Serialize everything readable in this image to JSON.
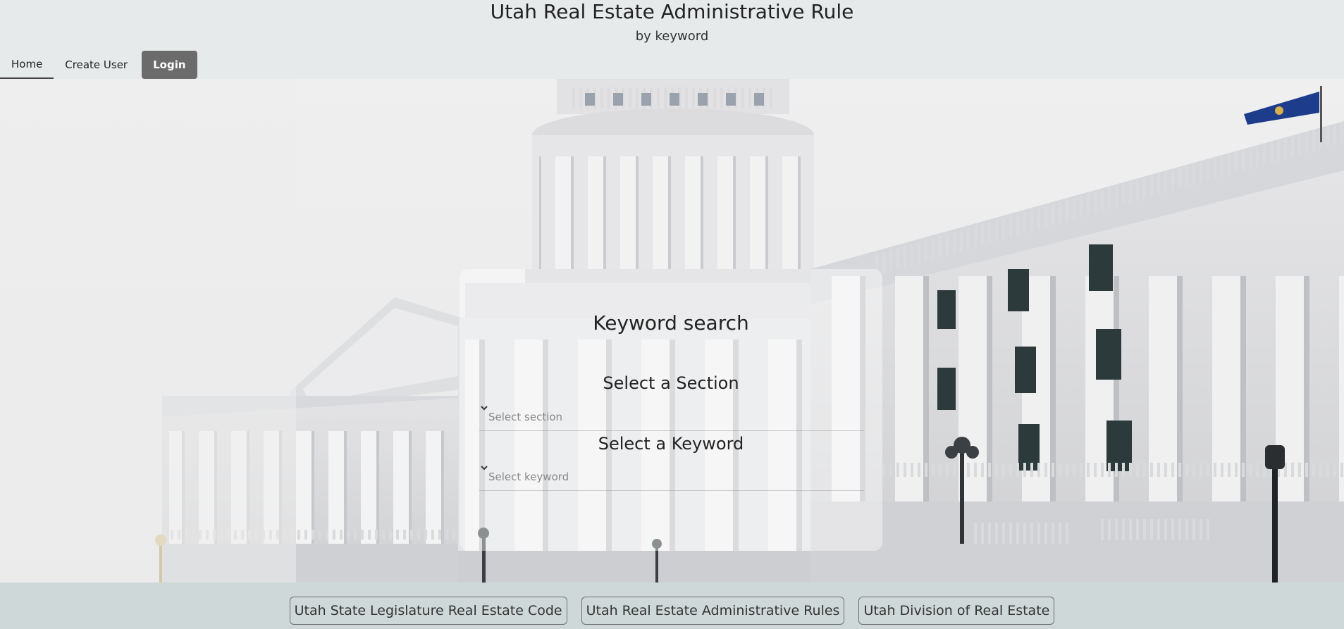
{
  "header": {
    "title": "Utah Real Estate Administrative Rule",
    "subtitle": "by keyword"
  },
  "nav": {
    "items": [
      {
        "label": "Home",
        "active": true
      },
      {
        "label": "Create User"
      },
      {
        "label": "Login"
      }
    ]
  },
  "search_card": {
    "title": "Keyword search",
    "section_label": "Select a Section",
    "section_placeholder": "Select section",
    "keyword_label": "Select a Keyword",
    "keyword_placeholder": "Select keyword"
  },
  "footer": {
    "links": [
      {
        "label": "Utah State Legislature Real Estate Code"
      },
      {
        "label": "Utah Real Estate Administrative Rules"
      },
      {
        "label": "Utah Division of Real Estate"
      }
    ]
  },
  "colors": {
    "header_bg": "#e7eaeb",
    "login_bg": "#6b6b6b",
    "footer_bg": "#cfd8d8"
  },
  "icons": [
    "chevron-down-icon",
    "capitol-building-image",
    "flag-icon"
  ]
}
